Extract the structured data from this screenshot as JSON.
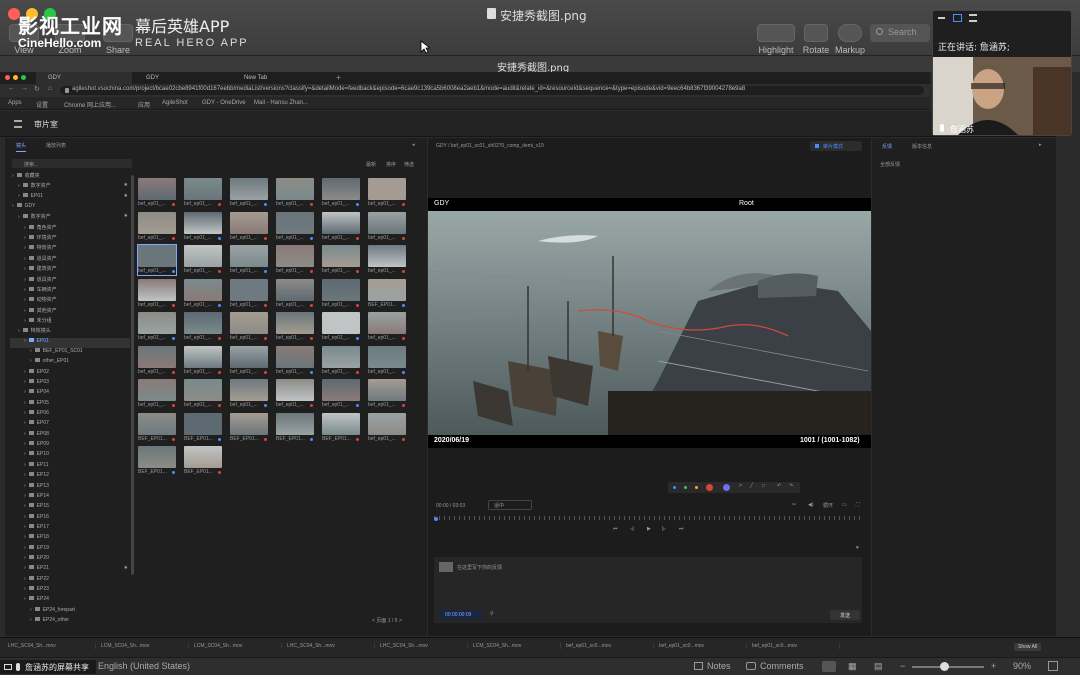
{
  "window": {
    "title": "安捷秀截图.png",
    "subtitle": "安捷秀截图.png",
    "watermark_title": "影视工业网",
    "watermark_url": "CineHello.com",
    "watermark_app": "幕后英雄APP",
    "watermark_sub": "REAL HERO APP"
  },
  "toolbar": {
    "view": "View",
    "zoom": "Zoom",
    "share": "Share",
    "highlight": "Highlight",
    "rotate": "Rotate",
    "markup": "Markup",
    "search_placeholder": "Search"
  },
  "browser": {
    "tabs": [
      "GDY",
      "GDY",
      "New Tab"
    ],
    "url": "agileshot.vsochina.com/project/bcae02cbe8941f00d167eebb/mediaList/versions?classify=&detailMode=feedback&episode=6cae9c139ca5b6008ea2aeb1&mode=audit&relate_id=&resourceId&sequence=&type=episode&vid=9eec64b8367f39004278e9a8",
    "bookmarks": [
      "Apps",
      "设置",
      "Chrome 网上应用...",
      "应用",
      "AgileShot",
      "GDY - OneDrive",
      "Mail - Hansu Zhan..."
    ]
  },
  "app": {
    "title": "审片室",
    "left_tabs": [
      "镜头",
      "播放列表"
    ],
    "filter_placeholder": "搜索...",
    "grid_options": [
      "最新",
      "排序",
      "筛选"
    ],
    "tree": [
      {
        "label": "收藏夹",
        "indent": 0
      },
      {
        "label": "数字资产",
        "indent": 1,
        "star": true
      },
      {
        "label": "EP01",
        "indent": 1,
        "star": true
      },
      {
        "label": "GDY",
        "indent": 0
      },
      {
        "label": "数字资产",
        "indent": 1,
        "star": true
      },
      {
        "label": "角色资产",
        "indent": 2
      },
      {
        "label": "环境资产",
        "indent": 2
      },
      {
        "label": "特效资产",
        "indent": 2
      },
      {
        "label": "道具资产",
        "indent": 2
      },
      {
        "label": "建筑资产",
        "indent": 2
      },
      {
        "label": "道具资产",
        "indent": 2
      },
      {
        "label": "车辆资产",
        "indent": 2
      },
      {
        "label": "动物资产",
        "indent": 2
      },
      {
        "label": "其他资产",
        "indent": 2
      },
      {
        "label": "未分组",
        "indent": 2
      },
      {
        "label": "特效镜头",
        "indent": 1
      },
      {
        "label": "EP01",
        "indent": 2,
        "sel": true
      },
      {
        "label": "BEF_EP01_SC01",
        "indent": 3
      },
      {
        "label": "other_EP01",
        "indent": 3
      },
      {
        "label": "EP02",
        "indent": 2
      },
      {
        "label": "EP03",
        "indent": 2
      },
      {
        "label": "EP04",
        "indent": 2
      },
      {
        "label": "EP05",
        "indent": 2
      },
      {
        "label": "EP06",
        "indent": 2
      },
      {
        "label": "EP07",
        "indent": 2
      },
      {
        "label": "EP08",
        "indent": 2
      },
      {
        "label": "EP09",
        "indent": 2
      },
      {
        "label": "EP10",
        "indent": 2
      },
      {
        "label": "EP11",
        "indent": 2
      },
      {
        "label": "EP12",
        "indent": 2
      },
      {
        "label": "EP13",
        "indent": 2
      },
      {
        "label": "EP14",
        "indent": 2
      },
      {
        "label": "EP15",
        "indent": 2
      },
      {
        "label": "EP16",
        "indent": 2
      },
      {
        "label": "EP17",
        "indent": 2
      },
      {
        "label": "EP18",
        "indent": 2
      },
      {
        "label": "EP19",
        "indent": 2
      },
      {
        "label": "EP20",
        "indent": 2
      },
      {
        "label": "EP21",
        "indent": 2,
        "star": true
      },
      {
        "label": "EP22",
        "indent": 2
      },
      {
        "label": "EP23",
        "indent": 2
      },
      {
        "label": "EP24",
        "indent": 2
      },
      {
        "label": "EP24_forepart",
        "indent": 3
      },
      {
        "label": "EP24_other",
        "indent": 3
      }
    ],
    "thumb_rows": [
      [
        "bef_ep01_...",
        "bef_ep01_...",
        "bef_ep01_...",
        "bef_ep01_...",
        "bef_ep01_...",
        "bef_ep01_..."
      ],
      [
        "bef_ep01_...",
        "bef_ep01_...",
        "bef_ep01_...",
        "bef_ep01_...",
        "bef_ep01_...",
        "bef_ep01_..."
      ],
      [
        "bef_ep01_...",
        "bef_ep01_...",
        "bef_ep01_...",
        "bef_ep01_...",
        "bef_ep01_...",
        "bef_ep01_..."
      ],
      [
        "bef_ep01_...",
        "bef_ep01_...",
        "bef_ep01_...",
        "bef_ep01_...",
        "bef_ep01_...",
        "BEF_EP01..."
      ],
      [
        "bef_ep01_...",
        "bef_ep01_...",
        "bef_ep01_...",
        "bef_ep01_...",
        "bef_ep01_...",
        "bef_ep01_..."
      ],
      [
        "bef_ep01_...",
        "bef_ep01_...",
        "bef_ep01_...",
        "bef_ep01_...",
        "bef_ep01_...",
        "bef_ep01_..."
      ],
      [
        "bef_ep01_...",
        "bef_ep01_...",
        "bef_ep01_...",
        "bef_ep01_...",
        "bef_ep01_...",
        "bef_ep01_..."
      ],
      [
        "BEF_EP01...",
        "BEF_EP01...",
        "BEF_EP01...",
        "BEF_EP01...",
        "BEF_EP01...",
        "bef_ep01_..."
      ],
      [
        "BEF_EP01...",
        "BEF_EP01..."
      ]
    ],
    "pagination": "< 页面 1 / 5 >",
    "shot_breadcrumb": "GDY  /  bef_ep01_sc01_sh0270_comp_demi_v19",
    "review_button": "审片模式",
    "video_left_label": "GDY",
    "video_center_label": "Root",
    "video_date": "2020/06/19",
    "video_frame": "1001 / (1001-1082)",
    "timecode": "00:00 / 03:03",
    "speed": "适中",
    "comment_placeholder": "在这里写下你的反馈",
    "comment_timecode": "00:00:00:09",
    "send_button": "发送",
    "right_tabs": [
      "反馈",
      "版本信息"
    ],
    "right_item": "全部反馈",
    "loop_label": "循环"
  },
  "bottom_tabs": [
    "LHC_SC04_Sh...mov",
    "LCM_SC04_Sh...mov",
    "LCM_SC04_Sh...mov",
    "LHC_SC04_Sh...mov",
    "LHC_SC04_Sh...mov",
    "LCM_SC04_Sh...mov",
    "bef_ep01_sc0...mov",
    "bef_ep01_sc0...mov",
    "bef_ep01_sc0...mov"
  ],
  "show_all": "Show All",
  "status": {
    "language": "English (United States)",
    "notes": "Notes",
    "comments": "Comments",
    "zoom": "90%"
  },
  "call": {
    "speaking": "正在讲话: 詹涵苏;",
    "name": "詹涵苏",
    "share": "詹涵苏的屏幕共享"
  }
}
